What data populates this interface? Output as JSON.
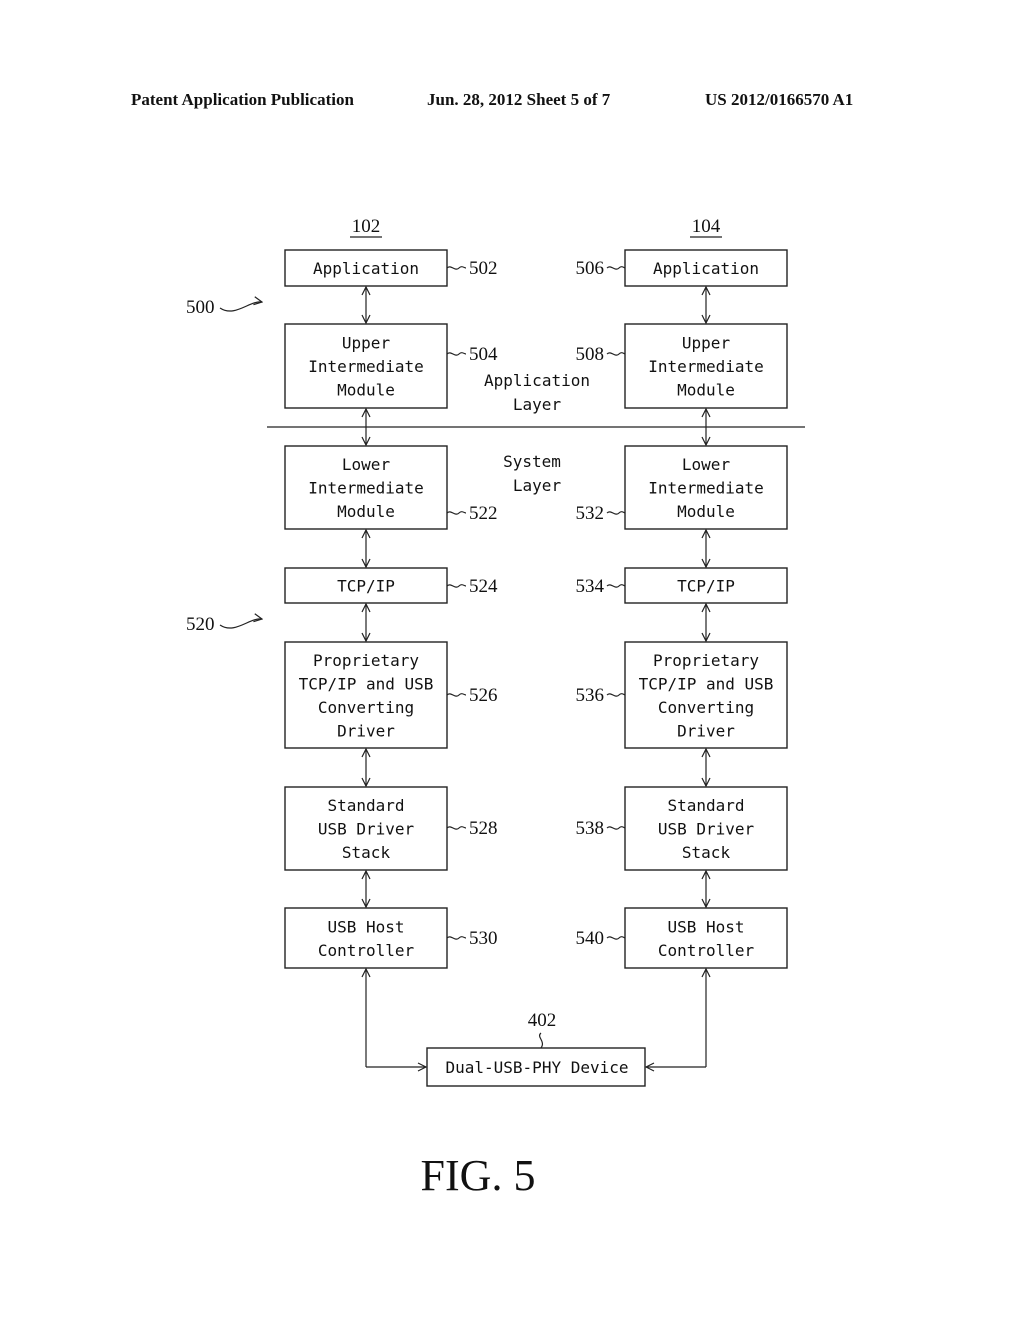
{
  "header": {
    "left": "Patent Application Publication",
    "middle": "Jun. 28, 2012  Sheet 5 of 7",
    "right": "US 2012/0166570 A1"
  },
  "figure_label": "FIG. 5",
  "stack_labels": {
    "left": "102",
    "right": "104"
  },
  "group_refs": {
    "application_group": "500",
    "system_group": "520"
  },
  "layer_labels": {
    "application": [
      "Application",
      "Layer"
    ],
    "system": [
      "System",
      "Layer"
    ]
  },
  "left_stack": [
    {
      "ref": "502",
      "lines": [
        "Application"
      ]
    },
    {
      "ref": "504",
      "lines": [
        "Upper",
        "Intermediate",
        "Module"
      ]
    },
    {
      "ref": "522",
      "lines": [
        "Lower",
        "Intermediate",
        "Module"
      ]
    },
    {
      "ref": "524",
      "lines": [
        "TCP/IP"
      ]
    },
    {
      "ref": "526",
      "lines": [
        "Proprietary",
        "TCP/IP and USB",
        "Converting",
        "Driver"
      ]
    },
    {
      "ref": "528",
      "lines": [
        "Standard",
        "USB Driver",
        "Stack"
      ]
    },
    {
      "ref": "530",
      "lines": [
        "USB Host",
        "Controller"
      ]
    }
  ],
  "right_stack": [
    {
      "ref": "506",
      "lines": [
        "Application"
      ]
    },
    {
      "ref": "508",
      "lines": [
        "Upper",
        "Intermediate",
        "Module"
      ]
    },
    {
      "ref": "532",
      "lines": [
        "Lower",
        "Intermediate",
        "Module"
      ]
    },
    {
      "ref": "534",
      "lines": [
        "TCP/IP"
      ]
    },
    {
      "ref": "536",
      "lines": [
        "Proprietary",
        "TCP/IP and USB",
        "Converting",
        "Driver"
      ]
    },
    {
      "ref": "538",
      "lines": [
        "Standard",
        "USB Driver",
        "Stack"
      ]
    },
    {
      "ref": "540",
      "lines": [
        "USB Host",
        "Controller"
      ]
    }
  ],
  "device": {
    "ref": "402",
    "label": "Dual-USB-PHY Device"
  }
}
